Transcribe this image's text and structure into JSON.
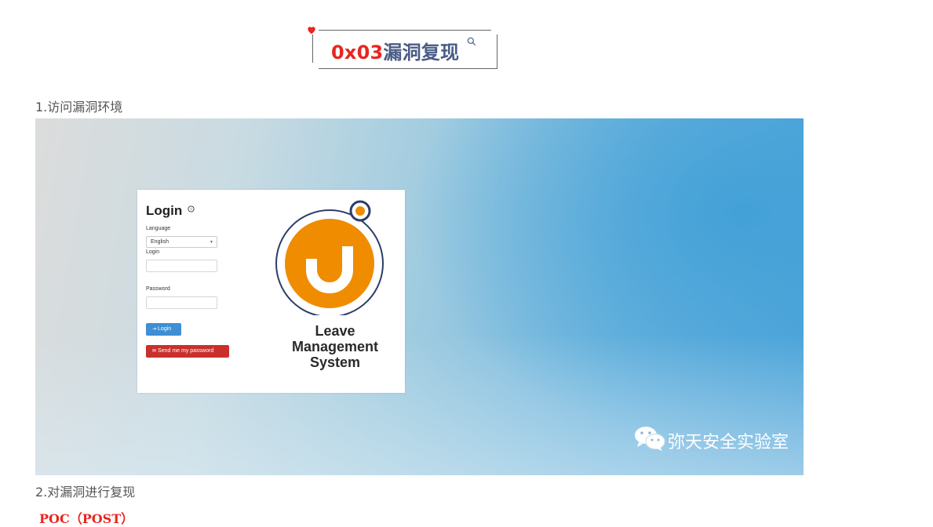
{
  "heading": {
    "number": "0x03",
    "title": "漏洞复现"
  },
  "steps": {
    "step1": "1.访问漏洞环境",
    "step2": "2.对漏洞进行复现"
  },
  "poc_label": "POC（POST）",
  "screenshot": {
    "login": {
      "title": "Login",
      "language_label": "Language",
      "language_value": "English",
      "login_label": "Login",
      "password_label": "Password",
      "login_button": "Login",
      "send_password_button": "Send me my password"
    },
    "app_name": {
      "line1": "Leave",
      "line2": "Management",
      "line3": "System"
    },
    "watermark": "弥天安全实验室"
  },
  "colors": {
    "accent_red": "#e8261f",
    "heading_blue": "#4a5d86",
    "logo_orange": "#ef8c00",
    "logo_navy": "#2c3e66"
  },
  "icons": [
    "heart-icon",
    "search-icon",
    "help-icon",
    "wechat-icon"
  ]
}
